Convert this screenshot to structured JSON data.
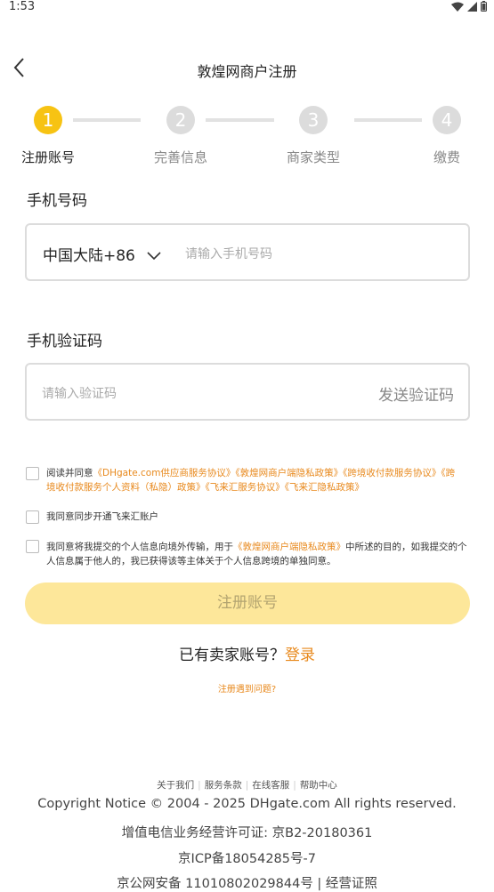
{
  "status": {
    "time": "1:53"
  },
  "header": {
    "title": "敦煌网商户注册"
  },
  "steps": [
    {
      "num": "1",
      "label": "注册账号",
      "active": true
    },
    {
      "num": "2",
      "label": "完善信息",
      "active": false
    },
    {
      "num": "3",
      "label": "商家类型",
      "active": false
    },
    {
      "num": "4",
      "label": "缴费",
      "active": false
    }
  ],
  "phone": {
    "label": "手机号码",
    "country": "中国大陆+86",
    "placeholder": "请输入手机号码"
  },
  "code": {
    "label": "手机验证码",
    "placeholder": "请输入验证码",
    "send": "发送验证码"
  },
  "agreements": {
    "a1_prefix": "阅读并同意",
    "a1_links": "《DHgate.com供应商服务协议》《敦煌网商户端隐私政策》《跨境收付款服务协议》《跨境收付款服务个人资料（私隐）政策》《飞来汇服务协议》《飞来汇隐私政策》",
    "a2": "我同意同步开通飞来汇账户",
    "a3_prefix": "我同意将我提交的个人信息向境外传输，用于",
    "a3_link": "《敦煌网商户端隐私政策》",
    "a3_suffix": "中所述的目的，如我提交的个人信息属于他人的，我已获得该等主体关于个人信息跨境的单独同意。"
  },
  "register_button": "注册账号",
  "login": {
    "prompt": "已有卖家账号？",
    "link": "登录"
  },
  "problem": "注册遇到问题?",
  "footer": {
    "links": [
      "关于我们",
      "服务条款",
      "在线客服",
      "帮助中心"
    ],
    "copyright": "Copyright Notice © 2004 - 2025 DHgate.com All rights reserved.",
    "license": "增值电信业务经营许可证: 京B2-20180361",
    "icp": "京ICP备18054285号-7",
    "security": "京公网安备 11010802029844号 | 经营证照"
  },
  "colors": {
    "accent": "#f7c313",
    "link": "#e8891d",
    "button_disabled": "#fde79a"
  }
}
